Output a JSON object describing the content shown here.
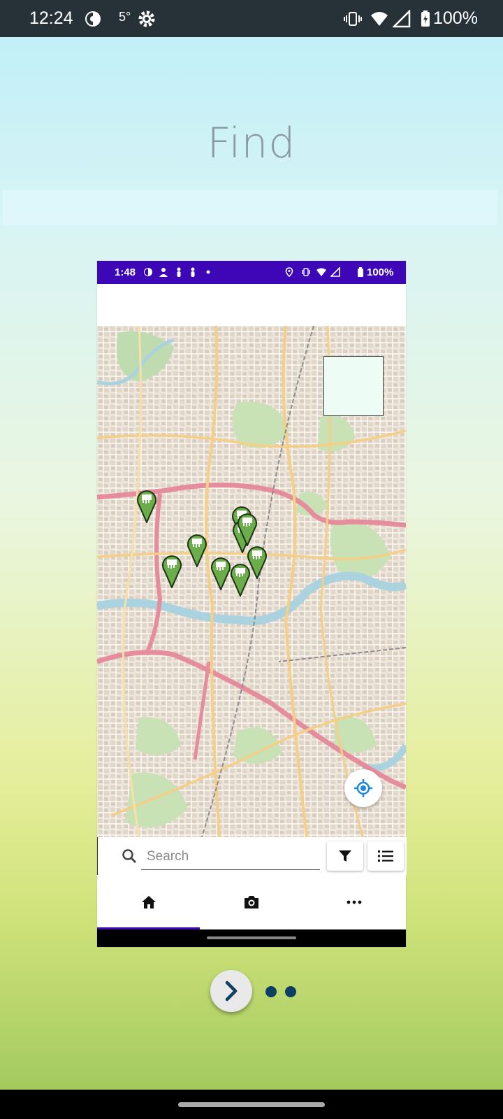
{
  "status_bar": {
    "time": "12:24",
    "temperature": "5°",
    "battery": "100%",
    "icons": [
      "sync-icon",
      "settings-icon",
      "vibrate-icon",
      "wifi-icon",
      "signal-icon",
      "battery-icon"
    ]
  },
  "page": {
    "title": "Find"
  },
  "inner_screenshot": {
    "status_bar": {
      "time": "1:48",
      "battery": "100%",
      "accent_color": "#3d07b8"
    },
    "map": {
      "markers_count": 9,
      "marker_color": "#6aad4a"
    },
    "search": {
      "placeholder": "Search",
      "value": ""
    },
    "nav": {
      "items": [
        {
          "icon": "home-icon",
          "selected": true
        },
        {
          "icon": "camera-icon",
          "selected": false
        },
        {
          "icon": "more-icon",
          "selected": false
        }
      ]
    }
  },
  "pager": {
    "dots": 2
  }
}
